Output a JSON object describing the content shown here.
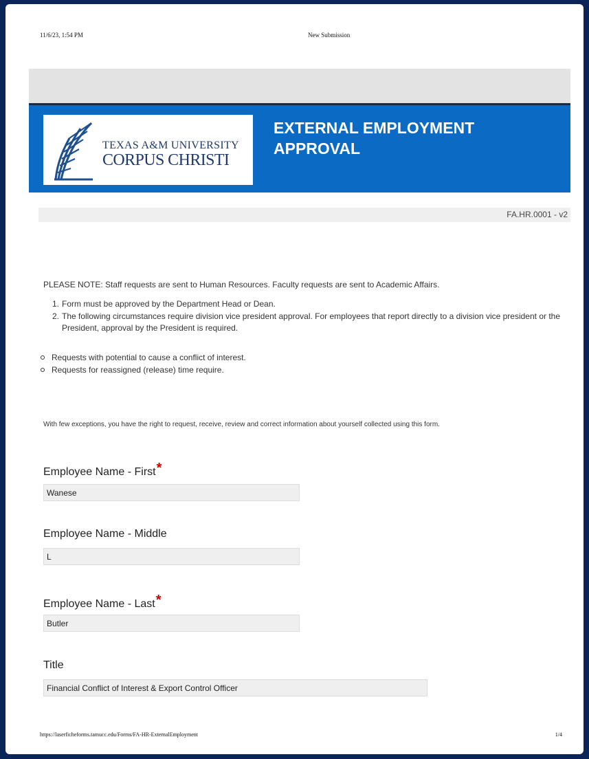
{
  "print_header": {
    "datetime": "11/6/23, 1:54 PM",
    "page_title": "New Submission"
  },
  "banner": {
    "logo_line1": "TEXAS A&M UNIVERSITY",
    "logo_line2": "CORPUS CHRISTI",
    "form_title": "EXTERNAL EMPLOYMENT APPROVAL",
    "colors": {
      "banner": "#0b6bc4",
      "logo_text": "#1f3a6b"
    }
  },
  "form_code": "FA.HR.0001 - v2",
  "instructions": {
    "note": "PLEASE NOTE: Staff requests are sent to Human Resources. Faculty requests are sent to Academic Affairs.",
    "ordered": [
      {
        "num": "1.",
        "text": "Form must be approved by the Department Head or Dean."
      },
      {
        "num": "2.",
        "text": "The following circumstances require division vice president approval. For employees that report directly to a division vice president or the President, approval by the President is required."
      }
    ],
    "bullets": [
      "Requests with potential to cause a conflict of interest.",
      "Requests for reassigned (release) time require."
    ],
    "privacy": "With few exceptions, you have the right to request, receive, review and correct information about yourself collected using this form."
  },
  "fields": {
    "first_name": {
      "label": "Employee Name - First",
      "required_mark": "*",
      "value": "Wanese"
    },
    "middle_name": {
      "label": "Employee Name - Middle",
      "value": "L"
    },
    "last_name": {
      "label": "Employee Name - Last",
      "required_mark": "*",
      "value": "Butler"
    },
    "title": {
      "label": "Title",
      "value": "Financial Conflict of Interest & Export Control Officer"
    }
  },
  "print_footer": {
    "url": "https://laserficheforms.tamucc.edu/Forms/FA-HR-ExternalEmployment",
    "page": "1/4"
  }
}
